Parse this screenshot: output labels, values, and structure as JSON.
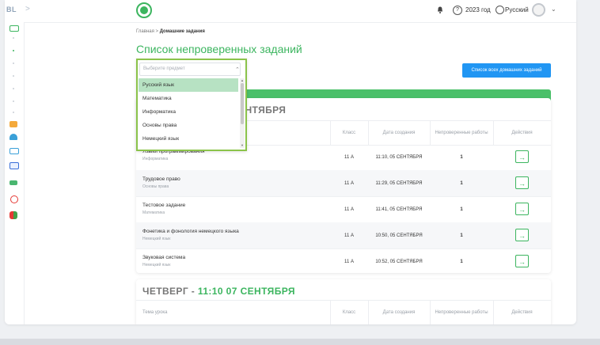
{
  "topbar": {
    "brand": "BL",
    "year": "2023 год",
    "language": "Русский"
  },
  "breadcrumb": {
    "home": "Главная",
    "separator": ">",
    "current": "Домашние задания"
  },
  "page_title": "Список непроверенных заданий",
  "all_homework_button": "Список всех домашних заданий",
  "subject_select": {
    "placeholder": "Выберите предмет",
    "options": [
      "Русский язык",
      "Математика",
      "Информатика",
      "Основы права",
      "Немецкий язык"
    ],
    "highlighted_index": 0
  },
  "groups": [
    {
      "day_visible": "СЕНТЯБРЯ",
      "columns": {
        "lesson": "",
        "class": "Класс",
        "created": "Дата создания",
        "unchecked": "Непроверенные работы",
        "actions": "Действия"
      },
      "rows": [
        {
          "lesson": "Языки программирования",
          "subject": "Информатика",
          "class": "11 А",
          "created": "11:10, 05 СЕНТЯБРЯ",
          "unchecked": "1"
        },
        {
          "lesson": "Трудовое право",
          "subject": "Основы права",
          "class": "11 А",
          "created": "11:29, 05 СЕНТЯБРЯ",
          "unchecked": "1"
        },
        {
          "lesson": "Тестовое задание",
          "subject": "Математика",
          "class": "11 А",
          "created": "11:41, 05 СЕНТЯБРЯ",
          "unchecked": "1"
        },
        {
          "lesson": "Фонетика и фонология немецкого языка",
          "subject": "Немецкий язык",
          "class": "11 А",
          "created": "10:50, 05 СЕНТЯБРЯ",
          "unchecked": "1"
        },
        {
          "lesson": "Звуковая система",
          "subject": "Немецкий язык",
          "class": "11 А",
          "created": "10:52, 05 СЕНТЯБРЯ",
          "unchecked": "1"
        }
      ]
    },
    {
      "day_prefix": "ЧЕТВЕРГ",
      "day_sep": " - ",
      "day_accent": "11:10 07 СЕНТЯБРЯ",
      "columns": {
        "lesson": "Тема урока",
        "class": "Класс",
        "created": "Дата создания",
        "unchecked": "Непроверенные работы",
        "actions": "Действия"
      }
    }
  ],
  "colors": {
    "accent": "#3cb55f",
    "button": "#2196f3",
    "dropdown_border": "#8bc34a"
  },
  "icons": {
    "action": "arrow-right-icon",
    "notifications": "bell-icon",
    "help": "help-icon",
    "language": "globe-icon"
  }
}
